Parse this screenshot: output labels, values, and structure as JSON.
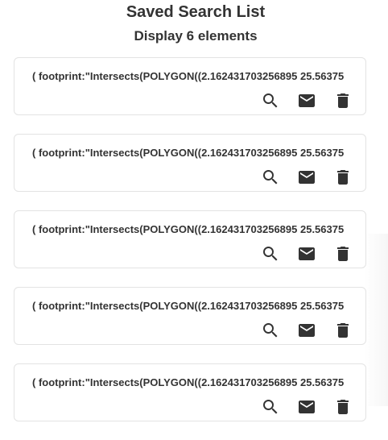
{
  "header": {
    "title": "Saved Search List",
    "subtitle": "Display 6 elements"
  },
  "searches": [
    {
      "query": "( footprint:\"Intersects(POLYGON((2.162431703256895 25.56375",
      "actions": {
        "search_icon": "search-icon",
        "email_icon": "email-icon",
        "delete_icon": "delete-icon"
      }
    },
    {
      "query": "( footprint:\"Intersects(POLYGON((2.162431703256895 25.56375",
      "actions": {
        "search_icon": "search-icon",
        "email_icon": "email-icon",
        "delete_icon": "delete-icon"
      }
    },
    {
      "query": "( footprint:\"Intersects(POLYGON((2.162431703256895 25.56375",
      "actions": {
        "search_icon": "search-icon",
        "email_icon": "email-icon",
        "delete_icon": "delete-icon"
      }
    },
    {
      "query": "( footprint:\"Intersects(POLYGON((2.162431703256895 25.56375",
      "actions": {
        "search_icon": "search-icon",
        "email_icon": "email-icon",
        "delete_icon": "delete-icon"
      }
    },
    {
      "query": "( footprint:\"Intersects(POLYGON((2.162431703256895 25.56375",
      "actions": {
        "search_icon": "search-icon",
        "email_icon": "email-icon",
        "delete_icon": "delete-icon"
      }
    }
  ],
  "colors": {
    "text": "#333333",
    "card_border": "#e3e3e3",
    "background": "#ffffff"
  }
}
